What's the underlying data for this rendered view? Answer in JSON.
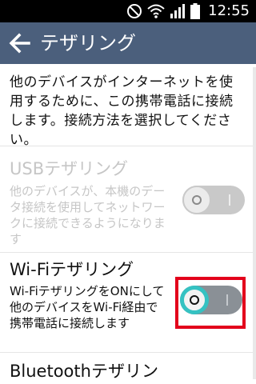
{
  "status_bar": {
    "time": "12:55",
    "icons": [
      "do-not-disturb-icon",
      "wifi-icon",
      "signal-icon",
      "battery-icon"
    ]
  },
  "app_bar": {
    "title": "テザリング",
    "back_icon": "arrow-left-icon"
  },
  "intro_text": "他のデバイスがインターネットを使用するために、この携帯電話に接続します。接続方法を選択してください。",
  "items": [
    {
      "title": "USBテザリング",
      "description": "他のデバイスが、本機のデータ接続を使用してネットワークに接続できるようになります",
      "enabled": false,
      "switch_on": false
    },
    {
      "title": "Wi-Fiテザリング",
      "description": "Wi-FiテザリングをONにして他のデバイスをWi-Fi経由で携帯電話に接続します",
      "enabled": true,
      "switch_on": false
    },
    {
      "title": "Bluetoothテザリン"
    }
  ],
  "colors": {
    "app_bar": "#4b5f7c",
    "accent": "#35c2c2",
    "highlight": "#e3001b"
  }
}
